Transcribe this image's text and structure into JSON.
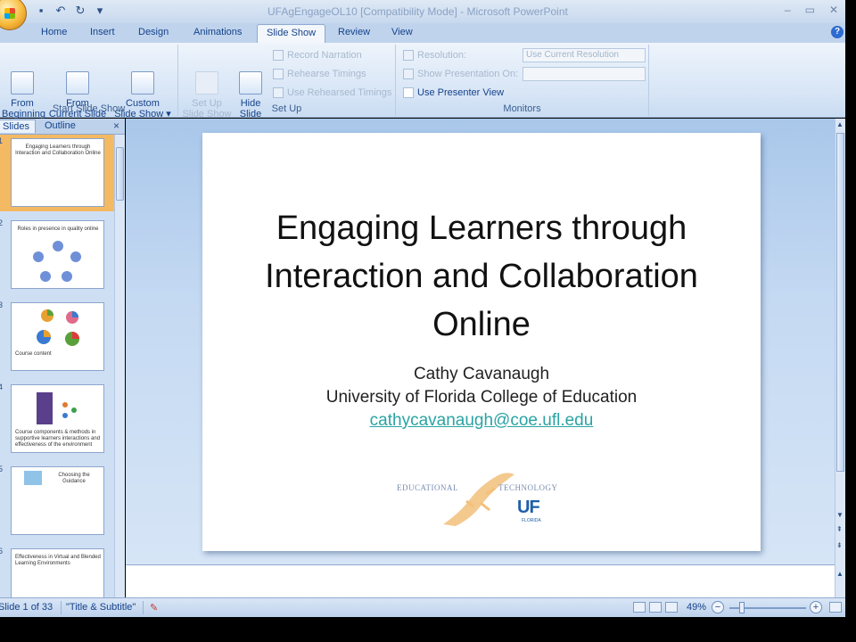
{
  "window": {
    "title": "UFAgEngageOL10 [Compatibility Mode] - Microsoft PowerPoint",
    "controls": [
      "–",
      "▭",
      "✕"
    ]
  },
  "quick_access": {
    "icons": [
      "save-icon",
      "undo-icon",
      "redo-icon",
      "customize-icon"
    ]
  },
  "tabs": [
    {
      "label": "Home"
    },
    {
      "label": "Insert"
    },
    {
      "label": "Design"
    },
    {
      "label": "Animations"
    },
    {
      "label": "Slide Show",
      "active": true
    },
    {
      "label": "Review"
    },
    {
      "label": "View"
    }
  ],
  "ribbon": {
    "start_group": {
      "label": "Start Slide Show",
      "buttons": [
        {
          "label": "From\nBeginning"
        },
        {
          "label": "From\nCurrent Slide"
        },
        {
          "label": "Custom\nSlide Show ▾"
        }
      ]
    },
    "setup_group": {
      "label": "Set Up",
      "buttons": [
        {
          "label": "Set Up\nSlide Show",
          "disabled": true
        },
        {
          "label": "Hide\nSlide"
        }
      ],
      "items": [
        {
          "label": "Record Narration",
          "disabled": true
        },
        {
          "label": "Rehearse Timings",
          "disabled": true
        },
        {
          "label": "Use Rehearsed Timings",
          "disabled": true
        }
      ]
    },
    "monitors_group": {
      "label": "Monitors",
      "resolution_label": "Resolution:",
      "resolution_value": "Use Current Resolution",
      "show_on_label": "Show Presentation On:",
      "show_on_value": "",
      "presenter_view_label": "Use Presenter View"
    }
  },
  "left_pane": {
    "tabs": [
      {
        "label": "Slides",
        "active": true
      },
      {
        "label": "Outline"
      }
    ],
    "close": "×",
    "thumbnails": [
      {
        "num": "1",
        "text": "Engaging Learners through Interaction and Collaboration Online",
        "selected": true
      },
      {
        "num": "2",
        "text": "Roles in presence in quality online"
      },
      {
        "num": "3",
        "text": "Course content"
      },
      {
        "num": "4",
        "text": "Course components & methods in supportive learners interactions and effectiveness of the environment"
      },
      {
        "num": "5",
        "text": "Choosing the Guidance"
      },
      {
        "num": "6",
        "text": "Effectiveness in Virtual and Blended Learning Environments"
      }
    ]
  },
  "slide": {
    "title": "Engaging Learners through Interaction and Collaboration Online",
    "author": "Cathy Cavanaugh",
    "affiliation": "University of Florida College of Education",
    "email": "cathycavanaugh@coe.ufl.edu",
    "logo_left": "EDUCATIONAL",
    "logo_right": "TECHNOLOGY",
    "logo_uf": "UF",
    "logo_florida": "FLORIDA",
    "accent_color": "#2aa3a3"
  },
  "status": {
    "slide_of": "Slide 1 of 33",
    "theme": "\"Title & Subtitle\"",
    "zoom": "49%",
    "zoom_fraction": 0.49
  }
}
